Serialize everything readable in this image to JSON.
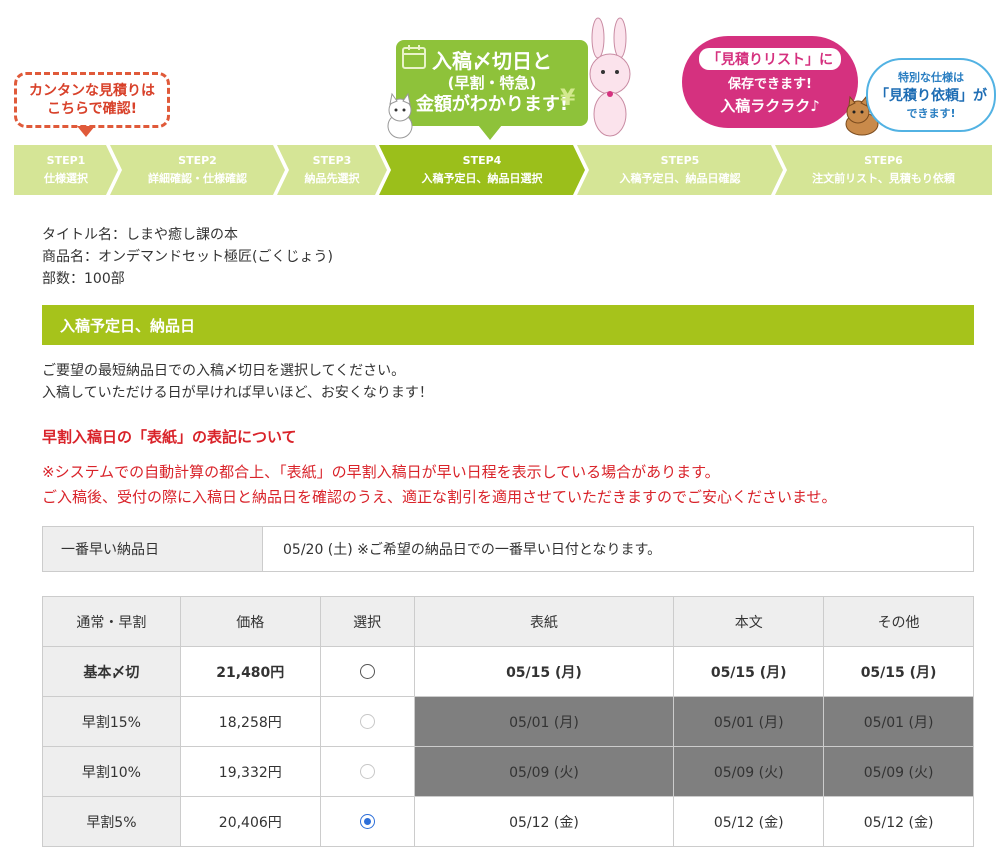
{
  "banner": {
    "bubble_left": [
      "カンタンな見積りは",
      "こちらで確認!"
    ],
    "bubble_green": [
      "入稿〆切日と",
      "(早割・特急)",
      "金額がわかります!"
    ],
    "yen": "¥",
    "bubble_pink": [
      "「見積りリスト」に",
      "保存できます!",
      "入稿ラクラク♪"
    ],
    "bubble_blue": [
      "特別な仕様は",
      "「見積り依頼」が",
      "できます!"
    ]
  },
  "steps": [
    {
      "num": "STEP1",
      "label": "仕様選択"
    },
    {
      "num": "STEP2",
      "label": "詳細確認・仕様確認"
    },
    {
      "num": "STEP3",
      "label": "納品先選択"
    },
    {
      "num": "STEP4",
      "label": "入稿予定日、納品日選択"
    },
    {
      "num": "STEP5",
      "label": "入稿予定日、納品日確認"
    },
    {
      "num": "STEP6",
      "label": "注文前リスト、見積もり依頼"
    }
  ],
  "info": {
    "title": "タイトル名：しまや癒し課の本",
    "product": "商品名：オンデマンドセット極匠(ごくじょう)",
    "copies": "部数：100部"
  },
  "section_header": "入稿予定日、納品日",
  "description": [
    "ご要望の最短納品日での入稿〆切日を選択してください。",
    "入稿していただける日が早ければ早いほど、お安くなります！"
  ],
  "notice": {
    "title": "早割入稿日の「表紙」の表記について",
    "lines": [
      "※システムでの自動計算の都合上、「表紙」の早割入稿日が早い日程を表示している場合があります。",
      "ご入稿後、受付の際に入稿日と納品日を確認のうえ、適正な割引を適用させていただきますのでご安心くださいませ。"
    ]
  },
  "earliest": {
    "label": "一番早い納品日",
    "value": "05/20 (土) ※ご希望の納品日での一番早い日付となります。"
  },
  "table": {
    "headers": [
      "通常・早割",
      "価格",
      "選択",
      "表紙",
      "本文",
      "その他"
    ],
    "rows": [
      {
        "plan": "基本〆切",
        "price": "21,480円",
        "cover": "05/15 (月)",
        "body": "05/15 (月)",
        "other": "05/15 (月)"
      },
      {
        "plan": "早割15%",
        "price": "18,258円",
        "cover": "05/01 (月)",
        "body": "05/01 (月)",
        "other": "05/01 (月)"
      },
      {
        "plan": "早割10%",
        "price": "19,332円",
        "cover": "05/09 (火)",
        "body": "05/09 (火)",
        "other": "05/09 (火)"
      },
      {
        "plan": "早割5%",
        "price": "20,406円",
        "cover": "05/12 (金)",
        "body": "05/12 (金)",
        "other": "05/12 (金)"
      }
    ]
  },
  "colors": {
    "accent": "#a6c31b",
    "step": "#d5e596",
    "step_active": "#9bbf1b",
    "notice": "#d9232a",
    "disabled_cell": "#7f7f7f"
  }
}
